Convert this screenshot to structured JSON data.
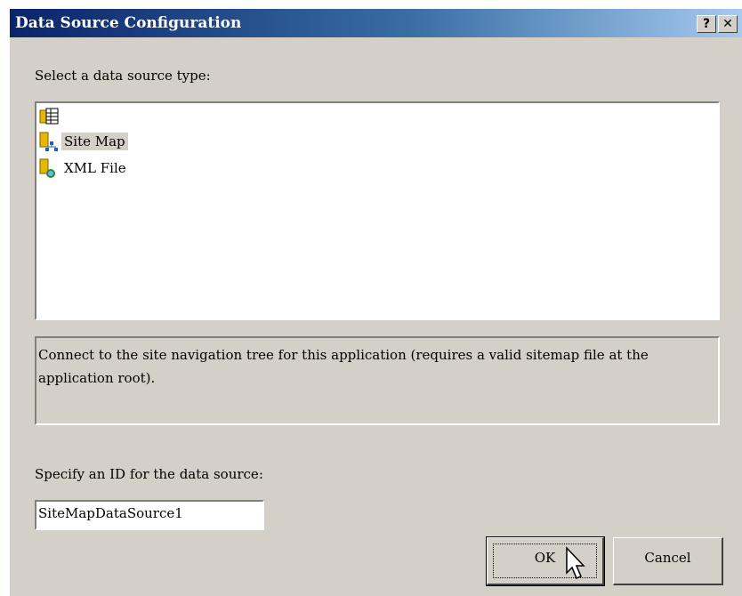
{
  "window": {
    "title": "Data Source Configuration",
    "help_label": "?",
    "close_label": "✕"
  },
  "select_label": "Select a data source type:",
  "source_types": [
    {
      "label": "",
      "icon": "database-grid-icon",
      "selected": false
    },
    {
      "label": "Site Map",
      "icon": "site-map-icon",
      "selected": true
    },
    {
      "label": "XML File",
      "icon": "xml-file-icon",
      "selected": false
    }
  ],
  "description": "Connect to the site navigation tree for this application (requires a valid sitemap file at the application root).",
  "id_label": "Specify an ID for the data source:",
  "id_value": "SiteMapDataSource1",
  "buttons": {
    "ok": "OK",
    "cancel": "Cancel"
  },
  "colors": {
    "titlebar_start": "#0a246a",
    "titlebar_end": "#a6caf0",
    "dialog_face": "#d4d0c8"
  }
}
